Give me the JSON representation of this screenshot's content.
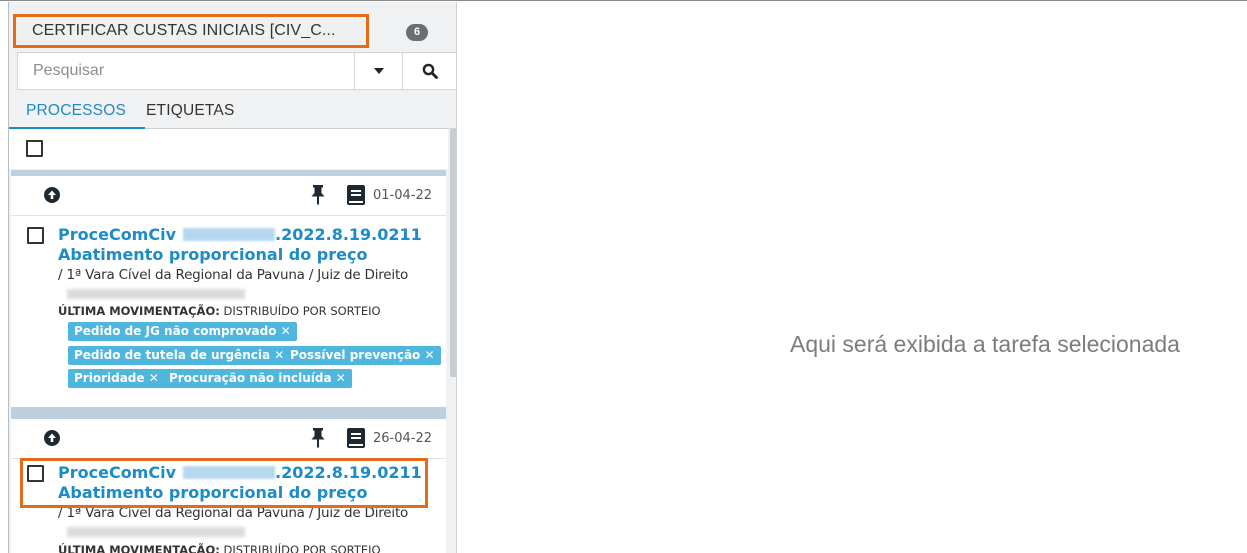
{
  "task": {
    "title": "CERTIFICAR CUSTAS INICIAIS [CIV_C...",
    "count": "6"
  },
  "search": {
    "placeholder": "Pesquisar"
  },
  "tabs": [
    {
      "label": "PROCESSOS"
    },
    {
      "label": "ETIQUETAS"
    }
  ],
  "cards": [
    {
      "date": "01-04-22",
      "title_prefix": "ProceComCiv",
      "title_suffix": ".2022.8.19.0211",
      "subject": "Abatimento proporcional do preço",
      "court": "/ 1ª Vara Cível da Regional da Pavuna / Juiz de Direito",
      "last_mov_label": "ÚLTIMA MOVIMENTAÇÃO:",
      "last_mov_value": "DISTRIBUÍDO POR SORTEIO",
      "tags": [
        "Pedido de JG não comprovado ✕",
        "Pedido de tutela de urgência ✕",
        "Possível prevenção ✕",
        "Prioridade ✕",
        "Procuração não incluída ✕"
      ]
    },
    {
      "date": "26-04-22",
      "title_prefix": "ProceComCiv",
      "title_suffix": ".2022.8.19.0211",
      "subject": "Abatimento proporcional do preço",
      "court": "/ 1ª Vara Cível da Regional da Pavuna / Juiz de Direito",
      "last_mov_label": "ÚLTIMA MOVIMENTAÇÃO:",
      "last_mov_value": "DISTRIBUÍDO POR SORTEIO"
    }
  ],
  "main": {
    "empty_message": "Aqui será exibida a tarefa selecionada"
  },
  "colors": {
    "accent": "#1c8bc6",
    "highlight": "#e36c1a",
    "tag": "#4fb6dd"
  },
  "icons": [
    "chevron-down-icon",
    "search-icon",
    "arrow-up-circle-icon",
    "pin-icon",
    "book-icon"
  ]
}
